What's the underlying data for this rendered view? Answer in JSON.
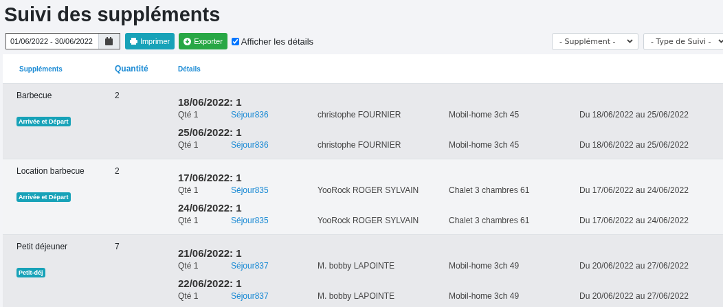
{
  "title": "Suivi des suppléments",
  "toolbar": {
    "date_range": "01/06/2022 - 30/06/2022",
    "print_button": "Imprimer",
    "export_button": "Exporter",
    "show_details": {
      "label": "Afficher les détails",
      "checked": true
    },
    "selects": [
      "- Supplément -",
      "- Type de Suivi -"
    ]
  },
  "table": {
    "columns": [
      "Suppléments",
      "Quantité",
      "Détails"
    ],
    "rows": [
      {
        "name": "Barbecue",
        "quantity": "2",
        "tag": "Arrivée et Départ",
        "details": [
          {
            "date": "18/06/2022: 1",
            "qty": "Qté 1",
            "stay": "Séjour836",
            "client": "christophe FOURNIER",
            "lodging": "Mobil-home 3ch 45",
            "period": "Du 18/06/2022 au 25/06/2022"
          },
          {
            "date": "25/06/2022: 1",
            "qty": "Qté 1",
            "stay": "Séjour836",
            "client": "christophe FOURNIER",
            "lodging": "Mobil-home 3ch 45",
            "period": "Du 18/06/2022 au 25/06/2022"
          }
        ]
      },
      {
        "name": "Location barbecue",
        "quantity": "2",
        "tag": "Arrivée et Départ",
        "details": [
          {
            "date": "17/06/2022: 1",
            "qty": "Qté 1",
            "stay": "Séjour835",
            "client": "YooRock ROGER SYLVAIN",
            "lodging": "Chalet 3 chambres 61",
            "period": "Du 17/06/2022 au 24/06/2022"
          },
          {
            "date": "24/06/2022: 1",
            "qty": "Qté 1",
            "stay": "Séjour835",
            "client": "YooRock ROGER SYLVAIN",
            "lodging": "Chalet 3 chambres 61",
            "period": "Du 17/06/2022 au 24/06/2022"
          }
        ]
      },
      {
        "name": "Petit déjeuner",
        "quantity": "7",
        "tag": "Petit-déj",
        "details": [
          {
            "date": "21/06/2022: 1",
            "qty": "Qté 1",
            "stay": "Séjour837",
            "client": "M. bobby LAPOINTE",
            "lodging": "Mobil-home 3ch 49",
            "period": "Du 20/06/2022 au 27/06/2022"
          },
          {
            "date": "22/06/2022: 1",
            "qty": "Qté 1",
            "stay": "Séjour837",
            "client": "M. bobby LAPOINTE",
            "lodging": "Mobil-home 3ch 49",
            "period": "Du 20/06/2022 au 27/06/2022"
          }
        ]
      }
    ]
  }
}
